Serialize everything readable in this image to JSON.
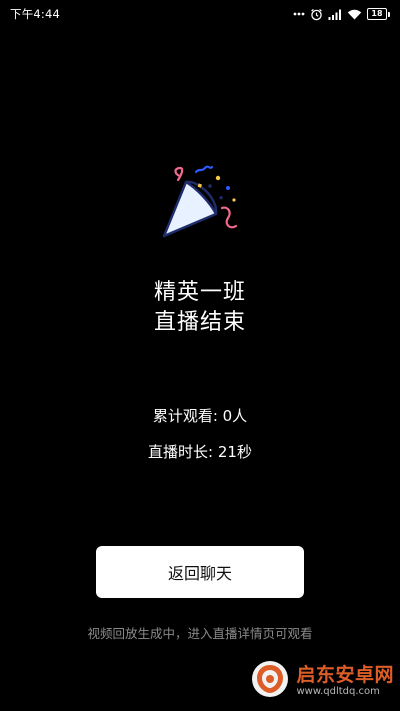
{
  "status_bar": {
    "time": "下午4:44",
    "battery_level": "18",
    "icons": [
      "dots-icon",
      "alarm-icon",
      "signal-icon",
      "wifi-icon",
      "battery-icon"
    ]
  },
  "end_screen": {
    "icon": "party-popper-icon",
    "title_line1": "精英一班",
    "title_line2": "直播结束",
    "views_text": "累计观看: 0人",
    "duration_text": "直播时长: 21秒",
    "back_button_label": "返回聊天",
    "hint": "视频回放生成中，进入直播详情页可观看"
  },
  "watermark": {
    "brand": "启东安卓网",
    "url": "www.qdltdq.com"
  },
  "colors": {
    "background": "#000000",
    "text": "#ffffff",
    "button_bg": "#ffffff",
    "button_text": "#111111",
    "hint_text": "#8a8a8a",
    "popper_fill": "#e8f1ff",
    "popper_stroke": "#1f2d6b",
    "accent_pink": "#f26a8d",
    "accent_blue": "#2e5bff",
    "accent_yellow": "#f7c948",
    "watermark_orange": "#e8622a"
  }
}
